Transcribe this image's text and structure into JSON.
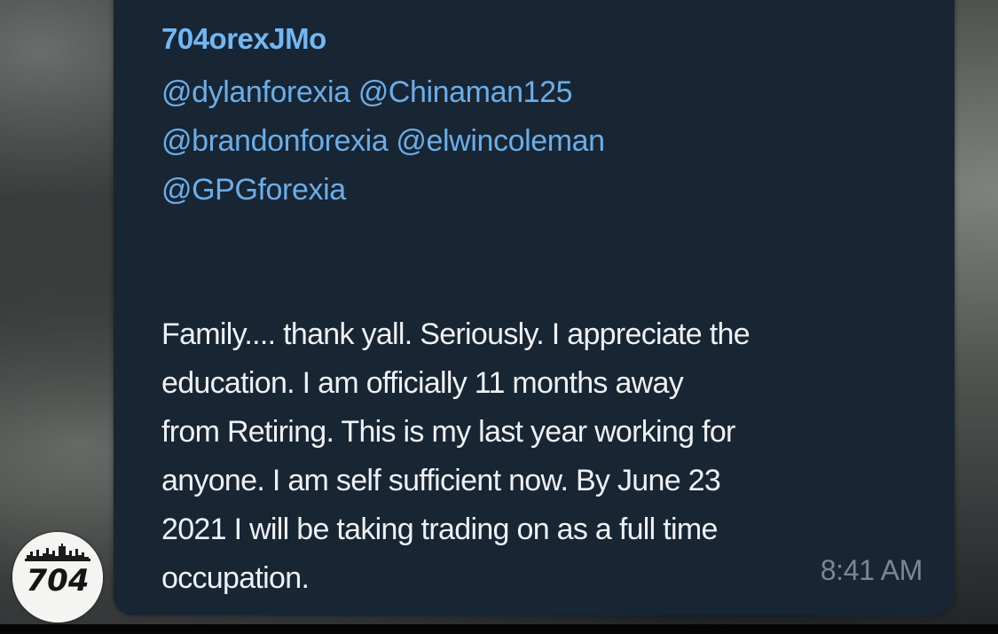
{
  "message": {
    "sender_name": "704orexJMo",
    "mention_lines": [
      "@dylanforexia @Chinaman125",
      "@brandonforexia @elwincoleman",
      "@GPGforexia"
    ],
    "body_text": "Family.... thank yall. Seriously. I appreciate the\neducation. I am officially 11 months away\nfrom Retiring. This is my last year working for\nanyone. I am self sufficient now. By June 23\n2021 I will be taking trading on as a full time\noccupation.",
    "timestamp": "8:41 AM"
  },
  "avatar": {
    "logo_text": "704",
    "icon": "skyline-logo-icon"
  },
  "colors": {
    "bubble_background": "#182533",
    "sender_name": "#71b8f3",
    "mention_link": "#6aaee8",
    "message_text": "#eef1f4",
    "timestamp": "#7b8894"
  }
}
